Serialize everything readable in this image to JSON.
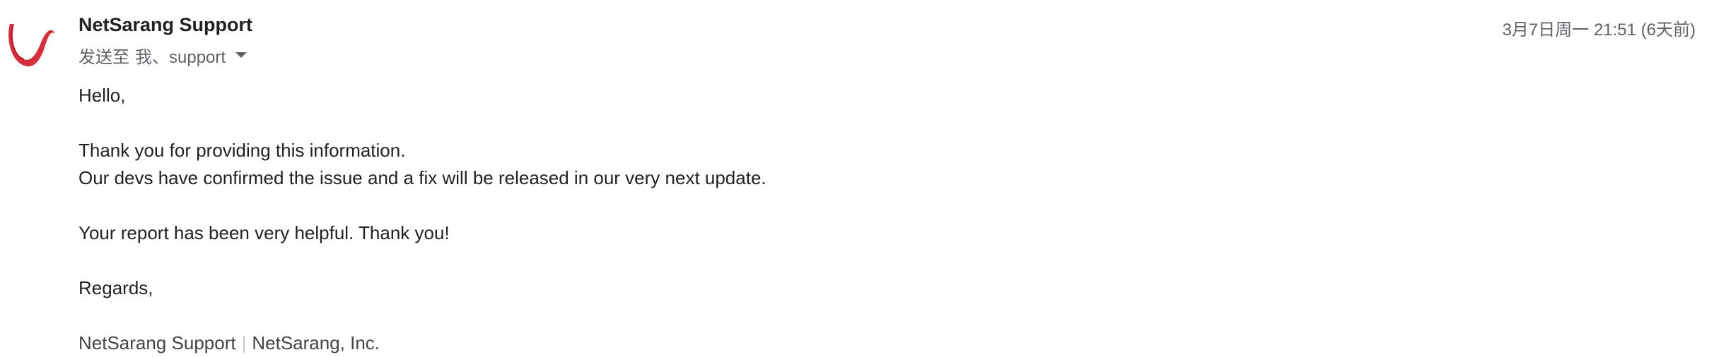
{
  "email": {
    "sender": {
      "name": "NetSarang Support",
      "avatar_icon": "netsarang-logo-icon",
      "avatar_color": "#d32f3c"
    },
    "recipients": {
      "to_label": "发送至",
      "list": "我、support",
      "expand_icon": "caret-down-icon"
    },
    "timestamp": "3月7日周一 21:51 (6天前)",
    "body": {
      "greeting": "Hello,",
      "line1": "Thank you for providing this information.",
      "line2": "Our devs have confirmed the issue and a fix will be released in our very next update.",
      "line3": "Your report has been very helpful. Thank you!",
      "closing": "Regards,",
      "signature": {
        "name": "NetSarang Support",
        "separator": "|",
        "company": "NetSarang, Inc."
      }
    }
  }
}
